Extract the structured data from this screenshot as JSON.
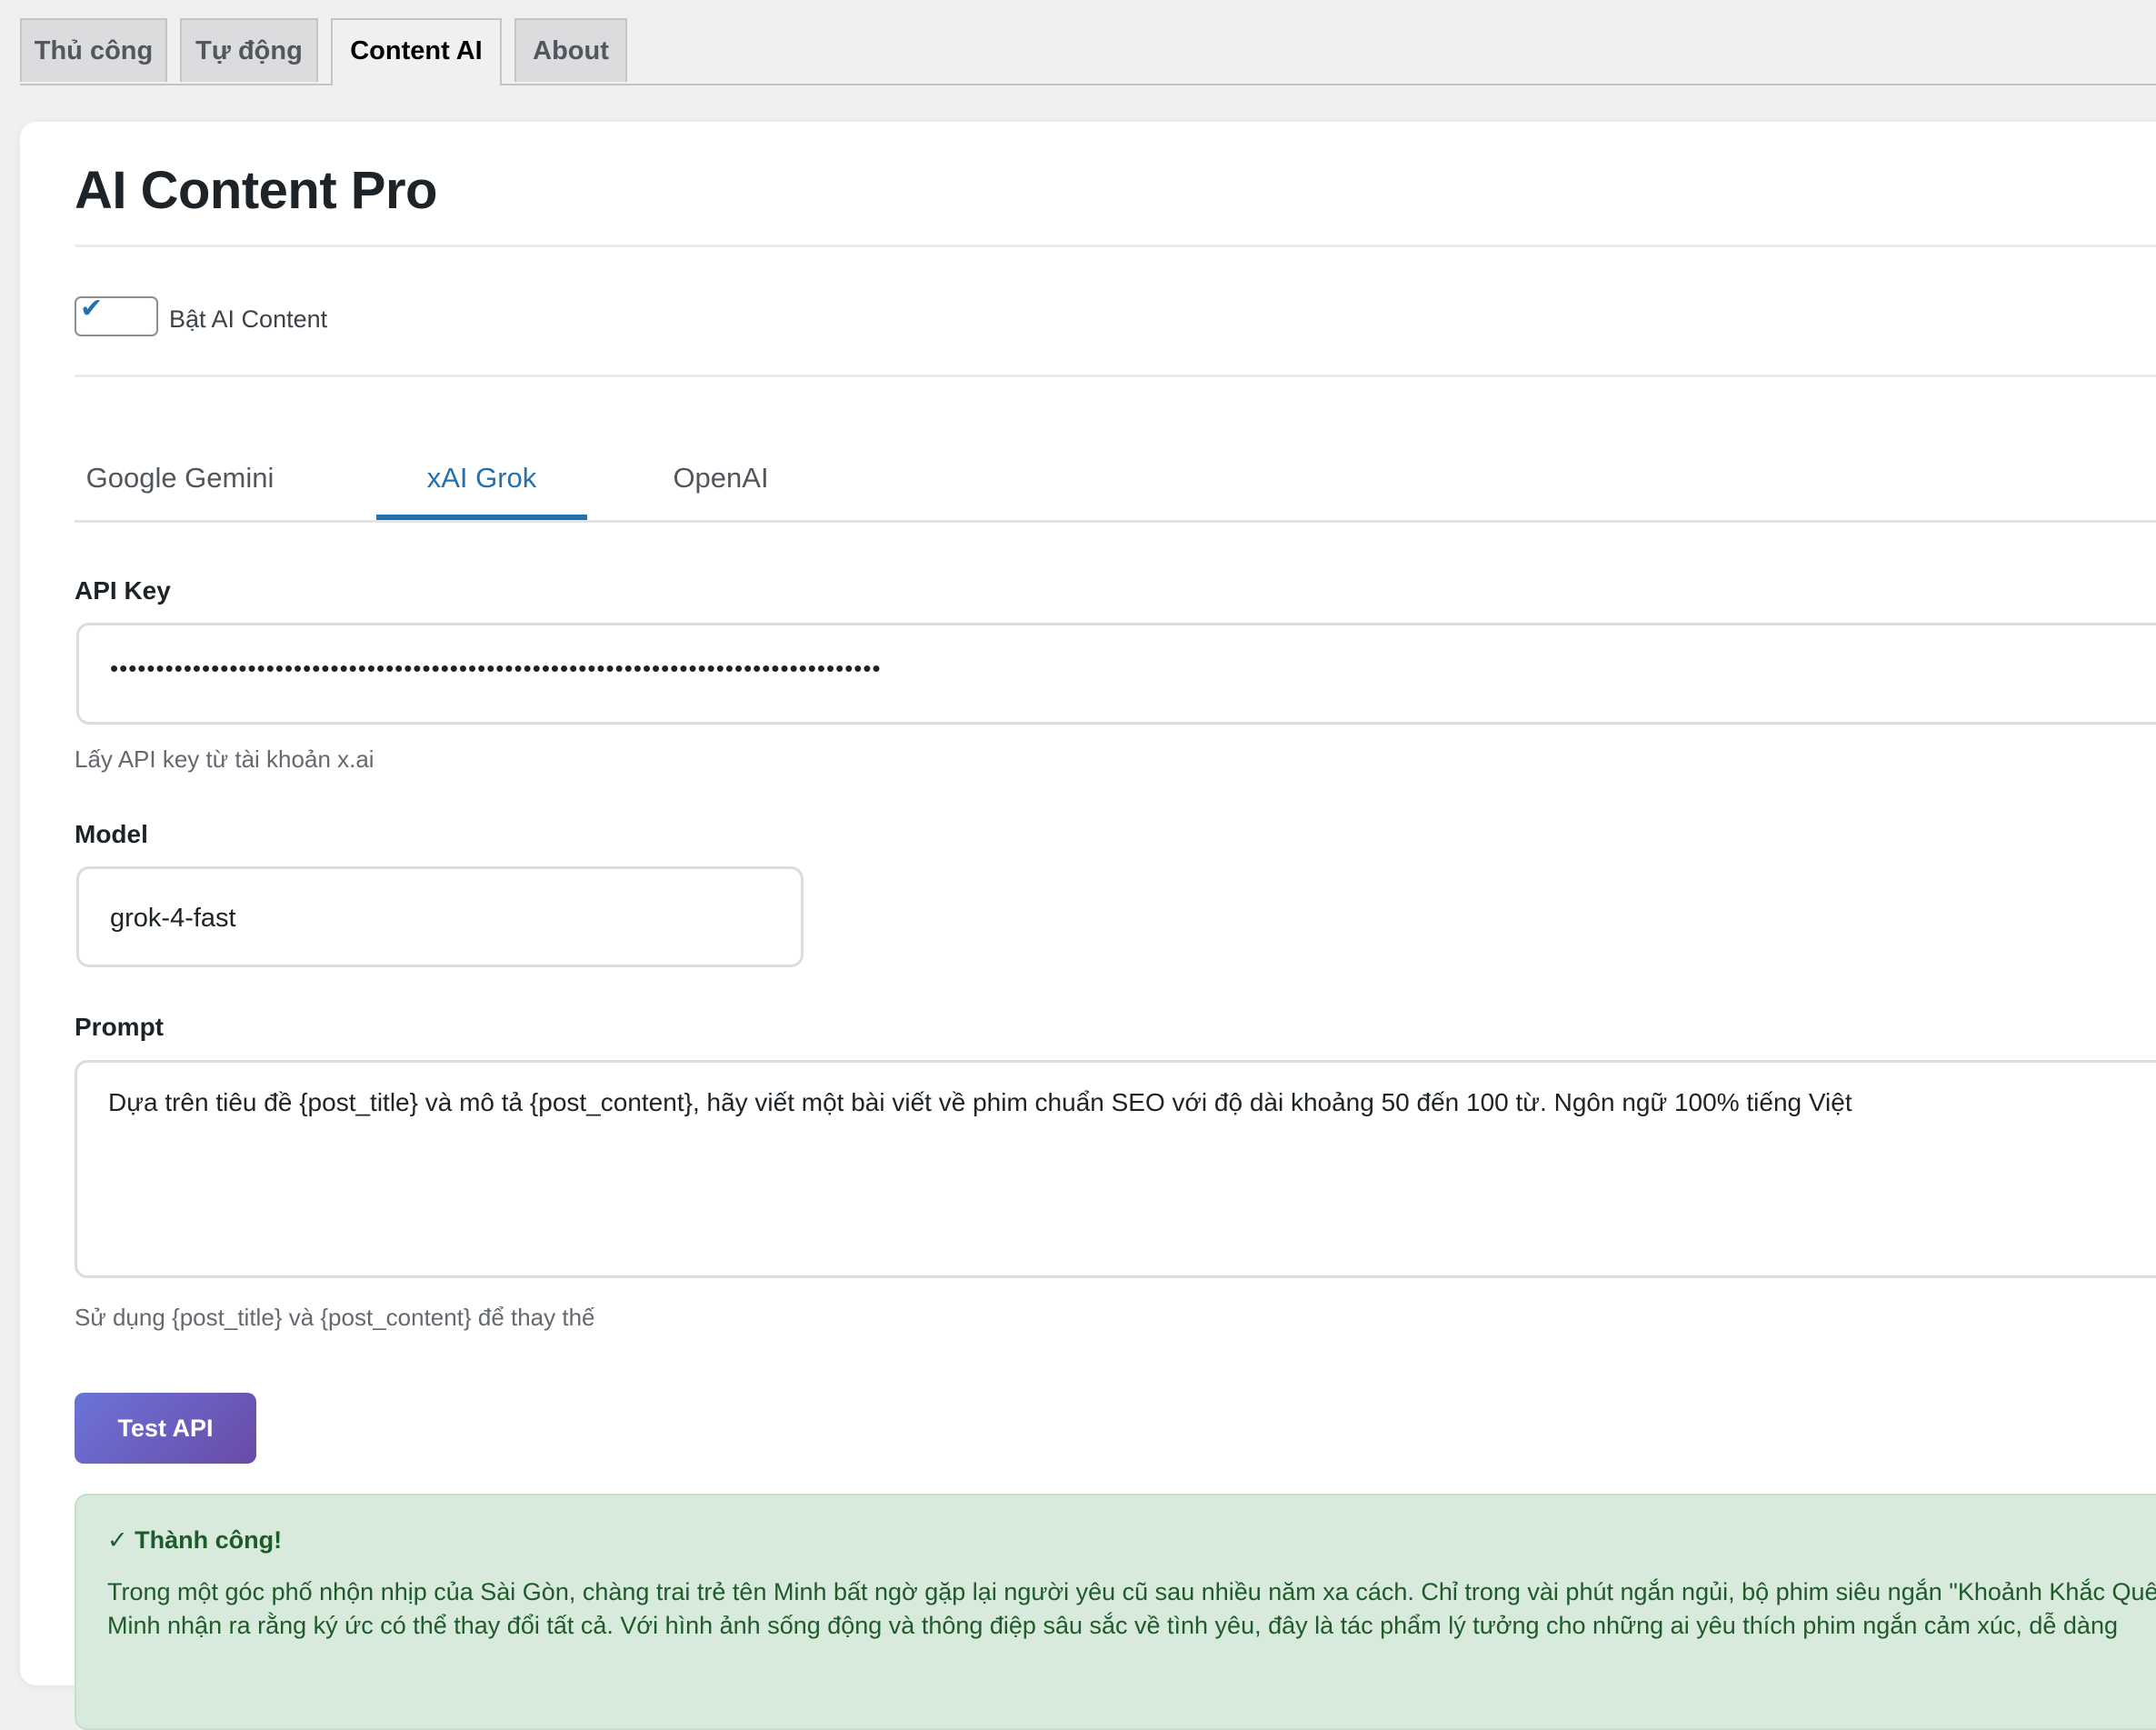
{
  "nav_tabs": [
    {
      "label": "Thủ công",
      "active": false
    },
    {
      "label": "Tự động",
      "active": false
    },
    {
      "label": "Content AI",
      "active": true
    },
    {
      "label": "About",
      "active": false
    }
  ],
  "page": {
    "title": "AI Content Pro"
  },
  "enable": {
    "label": "Bật AI Content",
    "checked": true
  },
  "provider_tabs": [
    {
      "label": "Google Gemini",
      "active": false
    },
    {
      "label": "xAI Grok",
      "active": true
    },
    {
      "label": "OpenAI",
      "active": false
    }
  ],
  "api_key": {
    "label": "API Key",
    "value": "••••••••••••••••••••••••••••••••••••••••••••••••••••••••••••••••••••••••••••••••••••",
    "help": "Lấy API key từ tài khoản x.ai"
  },
  "model": {
    "label": "Model",
    "value": "grok-4-fast"
  },
  "prompt": {
    "label": "Prompt",
    "value": "Dựa trên tiêu đề {post_title} và mô tả {post_content}, hãy viết một bài viết về phim chuẩn SEO với độ dài khoảng 50 đến 100  từ. Ngôn ngữ 100% tiếng Việt",
    "help": "Sử dụng {post_title} và {post_content} để thay thế"
  },
  "test_button": {
    "label": "Test API"
  },
  "notice": {
    "title": "✓ Thành công!",
    "body": "Trong một góc phố nhộn nhịp của Sài Gòn, chàng trai trẻ tên Minh bất ngờ gặp lại người yêu cũ sau nhiều năm xa cách. Chỉ trong vài phút ngắn ngủi, bộ phim siêu ngắn \"Khoảnh Khắc Quê khi Minh nhận ra rằng ký ức có thể thay đổi tất cả. Với hình ảnh sống động và thông điệp sâu sắc về tình yêu, đây là tác phẩm lý tưởng cho những ai yêu thích phim ngắn cảm xúc, dễ dàng",
    "status_color": "#1f5a2a"
  },
  "colors": {
    "accent": "#2271b1",
    "button_gradient_start": "#6b74d8",
    "button_gradient_end": "#6a4ba6",
    "notice_bg": "#d8eadc"
  }
}
